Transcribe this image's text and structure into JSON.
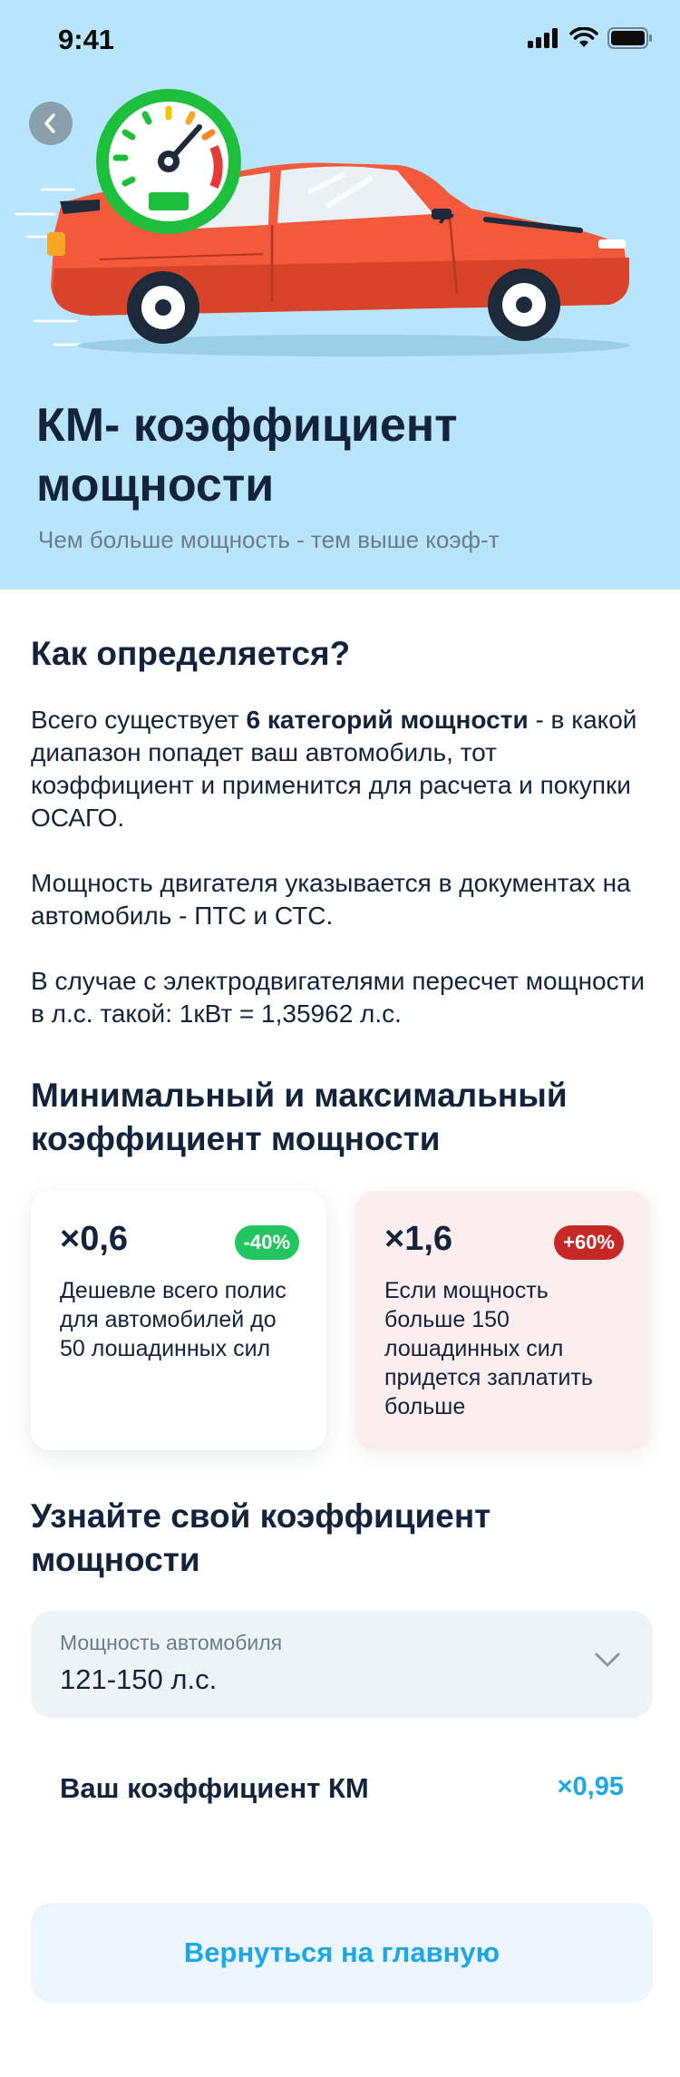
{
  "status_bar": {
    "time": "9:41"
  },
  "hero": {
    "title": "КМ- коэффициент мощности",
    "subtitle": "Чем больше мощность - тем выше коэф-т"
  },
  "how": {
    "title": "Как определяется?",
    "p1_before": "Всего существует ",
    "p1_bold": "6 категорий мощности",
    "p1_after": " - в какой диапазон попадет ваш автомобиль, тот коэффициент и применится для расчета и покупки ОСАГО.",
    "p2": "Мощность двигателя указывается в документах на автомобиль - ПТС и СТС.",
    "p3": "В случае с электродвигателями пересчет мощности в л.с. такой: 1кВт = 1,35962 л.с."
  },
  "minmax": {
    "title": "Минимальный и максимальный коэффициент мощности",
    "min": {
      "value": "×0,6",
      "badge": "-40%",
      "text": "Дешевле всего полис для автомобилей до 50 лошадинных сил"
    },
    "max": {
      "value": "×1,6",
      "badge": "+60%",
      "text": "Если мощность больше 150 лошадинных сил придется заплатить больше"
    }
  },
  "calc": {
    "title": "Узнайте свой коэффициент мощности",
    "select_label": "Мощность автомобиля",
    "select_value": "121-150 л.с.",
    "result_label": "Ваш коэффициент КМ",
    "result_value": "×0,95"
  },
  "home_button": "Вернуться на главную",
  "colors": {
    "hero_bg": "#b8e5fb",
    "accent": "#1ea7e8",
    "green_badge": "#22c55e",
    "red_badge": "#c62828",
    "car": "#f25a3b",
    "gauge": "#1fbf3e"
  },
  "icons": [
    "back-chevron-icon",
    "signal-icon",
    "wifi-icon",
    "battery-icon",
    "speedometer-icon",
    "car-icon",
    "chevron-down-icon"
  ]
}
